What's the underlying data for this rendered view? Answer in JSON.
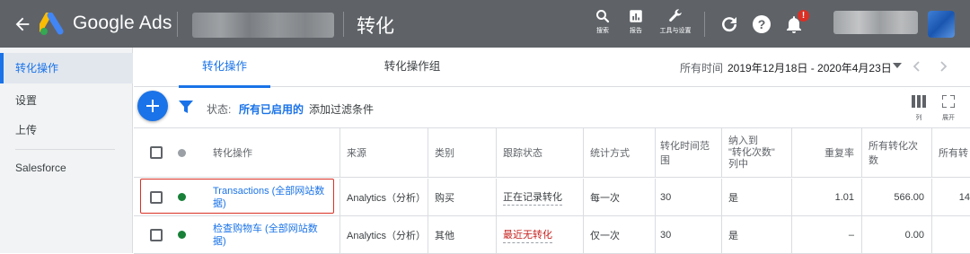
{
  "topbar": {
    "brand": "Google Ads",
    "page_title": "转化",
    "tools": {
      "search_label": "搜索",
      "reports_label": "报告",
      "tools_label": "工具与设置"
    },
    "notification_count": "!"
  },
  "sidebar": {
    "items": [
      {
        "label": "转化操作"
      },
      {
        "label": "设置"
      },
      {
        "label": "上传"
      },
      {
        "label": "Salesforce"
      }
    ]
  },
  "tabs": [
    {
      "label": "转化操作"
    },
    {
      "label": "转化操作组"
    }
  ],
  "date_range": {
    "label": "所有时间",
    "value": "2019年12月18日 - 2020年4月23日"
  },
  "filter_bar": {
    "status_label": "状态:",
    "status_value": "所有已启用的",
    "add_filter": "添加过滤条件",
    "columns_label": "列",
    "expand_label": "展开"
  },
  "table": {
    "headers": {
      "conversion_action": "转化操作",
      "source": "来源",
      "category": "类别",
      "tracking_status": "跟踪状态",
      "count": "统计方式",
      "window": "转化时间范围",
      "include_line1": "纳入到",
      "include_line2": "\"转化次数\"",
      "include_line3": "列中",
      "repeat_rate": "重复率",
      "all_conv": "所有转化次数",
      "all_conv_cut": "所有转"
    },
    "rows": [
      {
        "name": "Transactions (全部网站数据)",
        "source": "Analytics（分析）",
        "category": "购买",
        "tracking_status": "正在记录转化",
        "count": "每一次",
        "window": "30",
        "include": "是",
        "repeat_rate": "1.01",
        "all_conv": "566.00",
        "all_conv_cut": "14"
      },
      {
        "name": "检查购物车 (全部网站数据)",
        "source": "Analytics（分析）",
        "category": "其他",
        "tracking_status": "最近无转化",
        "count": "仅一次",
        "window": "30",
        "include": "是",
        "repeat_rate": "–",
        "all_conv": "0.00",
        "all_conv_cut": ""
      }
    ]
  },
  "colors": {
    "topbar": "#5f6368",
    "accent": "#1a73e8",
    "enabled_dot": "#188038",
    "status_dot_header": "#9aa0a6",
    "warning_text": "#c5221f",
    "highlight": "#d93025"
  }
}
